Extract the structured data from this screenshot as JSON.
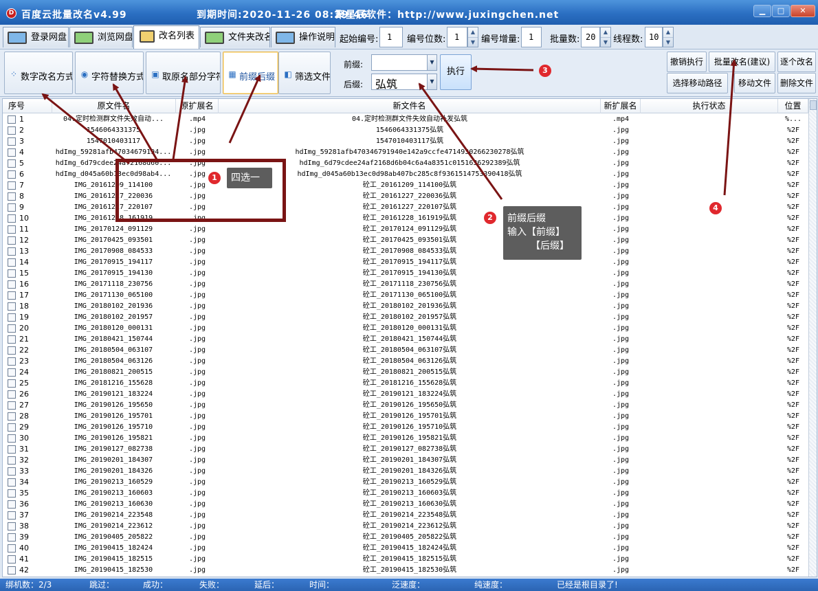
{
  "window": {
    "title": "百度云批量改名v4.99",
    "expiry": "到期时间:2020-11-26 08:29:46",
    "company": "聚星辰软件：http://www.juxingchen.net"
  },
  "tabs": [
    {
      "label": "登录网盘"
    },
    {
      "label": "浏览网盘"
    },
    {
      "label": "改名列表"
    },
    {
      "label": "文件夹改名"
    },
    {
      "label": "操作说明"
    }
  ],
  "header_fields": {
    "start_label": "起始编号:",
    "start_value": "1",
    "digits_label": "编号位数:",
    "digits_value": "1",
    "inc_label": "编号增量:",
    "inc_value": "1",
    "batch_label": "批量数:",
    "batch_value": "20",
    "threads_label": "线程数:",
    "threads_value": "10"
  },
  "methods": [
    {
      "label": "数字改名方式"
    },
    {
      "label": "字符替换方式"
    },
    {
      "label": "取原名部分字符"
    },
    {
      "label": "前缀后缀"
    },
    {
      "label": "筛选文件"
    }
  ],
  "affix": {
    "prefix_label": "前缀:",
    "prefix_value": "",
    "suffix_label": "后缀:",
    "suffix_value": "弘筑",
    "exec_label": "执行"
  },
  "actions": [
    "撤销执行",
    "批量改名(建议)",
    "逐个改名",
    "选择移动路径",
    "移动文件",
    "删除文件"
  ],
  "columns": [
    "序号",
    "原文件名",
    "原扩展名",
    "新文件名",
    "新扩展名",
    "执行状态",
    "位置"
  ],
  "rows": [
    [
      "1",
      "04.定时检测群文件失效自动...",
      ".mp4",
      "04.定时检测群文件失效自动补发弘筑",
      ".mp4",
      "%..."
    ],
    [
      "2",
      "1546064331375",
      ".jpg",
      "1546064331375弘筑",
      ".jpg",
      "%2F"
    ],
    [
      "3",
      "1547010403117",
      ".jpg",
      "1547010403117弘筑",
      ".jpg",
      "%2F"
    ],
    [
      "4",
      "hdImg_59281afb47034679194...",
      ".jpg",
      "hdImg_59281afb470346791940e142a9ccfe4714930266230278弘筑",
      ".jpg",
      "%2F"
    ],
    [
      "5",
      "hdImg_6d79cdee24af2168d60...",
      ".jpg",
      "hdImg_6d79cdee24af2168d6b04c6a4a8351c0151636292389弘筑",
      ".jpg",
      "%2F"
    ],
    [
      "6",
      "hdImg_d045a60b13ec0d98ab4...",
      ".jpg",
      "hdImg_d045a60b13ec0d98ab407bc285c8f9361514753390418弘筑",
      ".jpg",
      "%2F"
    ],
    [
      "7",
      "IMG_20161209_114100",
      ".jpg",
      "砼工_20161209_114100弘筑",
      ".jpg",
      "%2F"
    ],
    [
      "8",
      "IMG_20161227_220036",
      ".jpg",
      "砼工_20161227_220036弘筑",
      ".jpg",
      "%2F"
    ],
    [
      "9",
      "IMG_20161227_220107",
      ".jpg",
      "砼工_20161227_220107弘筑",
      ".jpg",
      "%2F"
    ],
    [
      "10",
      "IMG_20161228_161919",
      ".jpg",
      "砼工_20161228_161919弘筑",
      ".jpg",
      "%2F"
    ],
    [
      "11",
      "IMG_20170124_091129",
      ".jpg",
      "砼工_20170124_091129弘筑",
      ".jpg",
      "%2F"
    ],
    [
      "12",
      "IMG_20170425_093501",
      ".jpg",
      "砼工_20170425_093501弘筑",
      ".jpg",
      "%2F"
    ],
    [
      "13",
      "IMG_20170908_084533",
      ".jpg",
      "砼工_20170908_084533弘筑",
      ".jpg",
      "%2F"
    ],
    [
      "14",
      "IMG_20170915_194117",
      ".jpg",
      "砼工_20170915_194117弘筑",
      ".jpg",
      "%2F"
    ],
    [
      "15",
      "IMG_20170915_194130",
      ".jpg",
      "砼工_20170915_194130弘筑",
      ".jpg",
      "%2F"
    ],
    [
      "16",
      "IMG_20171118_230756",
      ".jpg",
      "砼工_20171118_230756弘筑",
      ".jpg",
      "%2F"
    ],
    [
      "17",
      "IMG_20171130_065100",
      ".jpg",
      "砼工_20171130_065100弘筑",
      ".jpg",
      "%2F"
    ],
    [
      "18",
      "IMG_20180102_201936",
      ".jpg",
      "砼工_20180102_201936弘筑",
      ".jpg",
      "%2F"
    ],
    [
      "19",
      "IMG_20180102_201957",
      ".jpg",
      "砼工_20180102_201957弘筑",
      ".jpg",
      "%2F"
    ],
    [
      "20",
      "IMG_20180120_000131",
      ".jpg",
      "砼工_20180120_000131弘筑",
      ".jpg",
      "%2F"
    ],
    [
      "21",
      "IMG_20180421_150744",
      ".jpg",
      "砼工_20180421_150744弘筑",
      ".jpg",
      "%2F"
    ],
    [
      "22",
      "IMG_20180504_063107",
      ".jpg",
      "砼工_20180504_063107弘筑",
      ".jpg",
      "%2F"
    ],
    [
      "23",
      "IMG_20180504_063126",
      ".jpg",
      "砼工_20180504_063126弘筑",
      ".jpg",
      "%2F"
    ],
    [
      "24",
      "IMG_20180821_200515",
      ".jpg",
      "砼工_20180821_200515弘筑",
      ".jpg",
      "%2F"
    ],
    [
      "25",
      "IMG_20181216_155628",
      ".jpg",
      "砼工_20181216_155628弘筑",
      ".jpg",
      "%2F"
    ],
    [
      "26",
      "IMG_20190121_183224",
      ".jpg",
      "砼工_20190121_183224弘筑",
      ".jpg",
      "%2F"
    ],
    [
      "27",
      "IMG_20190126_195650",
      ".jpg",
      "砼工_20190126_195650弘筑",
      ".jpg",
      "%2F"
    ],
    [
      "28",
      "IMG_20190126_195701",
      ".jpg",
      "砼工_20190126_195701弘筑",
      ".jpg",
      "%2F"
    ],
    [
      "29",
      "IMG_20190126_195710",
      ".jpg",
      "砼工_20190126_195710弘筑",
      ".jpg",
      "%2F"
    ],
    [
      "30",
      "IMG_20190126_195821",
      ".jpg",
      "砼工_20190126_195821弘筑",
      ".jpg",
      "%2F"
    ],
    [
      "31",
      "IMG_20190127_082738",
      ".jpg",
      "砼工_20190127_082738弘筑",
      ".jpg",
      "%2F"
    ],
    [
      "32",
      "IMG_20190201_184307",
      ".jpg",
      "砼工_20190201_184307弘筑",
      ".jpg",
      "%2F"
    ],
    [
      "33",
      "IMG_20190201_184326",
      ".jpg",
      "砼工_20190201_184326弘筑",
      ".jpg",
      "%2F"
    ],
    [
      "34",
      "IMG_20190213_160529",
      ".jpg",
      "砼工_20190213_160529弘筑",
      ".jpg",
      "%2F"
    ],
    [
      "35",
      "IMG_20190213_160603",
      ".jpg",
      "砼工_20190213_160603弘筑",
      ".jpg",
      "%2F"
    ],
    [
      "36",
      "IMG_20190213_160630",
      ".jpg",
      "砼工_20190213_160630弘筑",
      ".jpg",
      "%2F"
    ],
    [
      "37",
      "IMG_20190214_223548",
      ".jpg",
      "砼工_20190214_223548弘筑",
      ".jpg",
      "%2F"
    ],
    [
      "38",
      "IMG_20190214_223612",
      ".jpg",
      "砼工_20190214_223612弘筑",
      ".jpg",
      "%2F"
    ],
    [
      "39",
      "IMG_20190405_205822",
      ".jpg",
      "砼工_20190405_205822弘筑",
      ".jpg",
      "%2F"
    ],
    [
      "40",
      "IMG_20190415_182424",
      ".jpg",
      "砼工_20190415_182424弘筑",
      ".jpg",
      "%2F"
    ],
    [
      "41",
      "IMG_20190415_182515",
      ".jpg",
      "砼工_20190415_182515弘筑",
      ".jpg",
      "%2F"
    ],
    [
      "42",
      "IMG_20190415_182530",
      ".jpg",
      "砼工_20190415_182530弘筑",
      ".jpg",
      "%2F"
    ]
  ],
  "status": {
    "bind": "绑机数：2/3",
    "skip": "跳过：",
    "success": "成功：",
    "fail": "失败：",
    "delay": "延后：",
    "time": "时间：",
    "speed": "泛速度：",
    "pure_speed": "纯速度：",
    "message": "已经是根目录了!"
  },
  "annotations": {
    "badge1": "1",
    "note1": "四选一",
    "badge2": "2",
    "note2": [
      "前缀后缀",
      "输入【前缀】",
      "【后缀】"
    ],
    "badge3": "3",
    "badge4": "4",
    "color": "#e0282d"
  }
}
